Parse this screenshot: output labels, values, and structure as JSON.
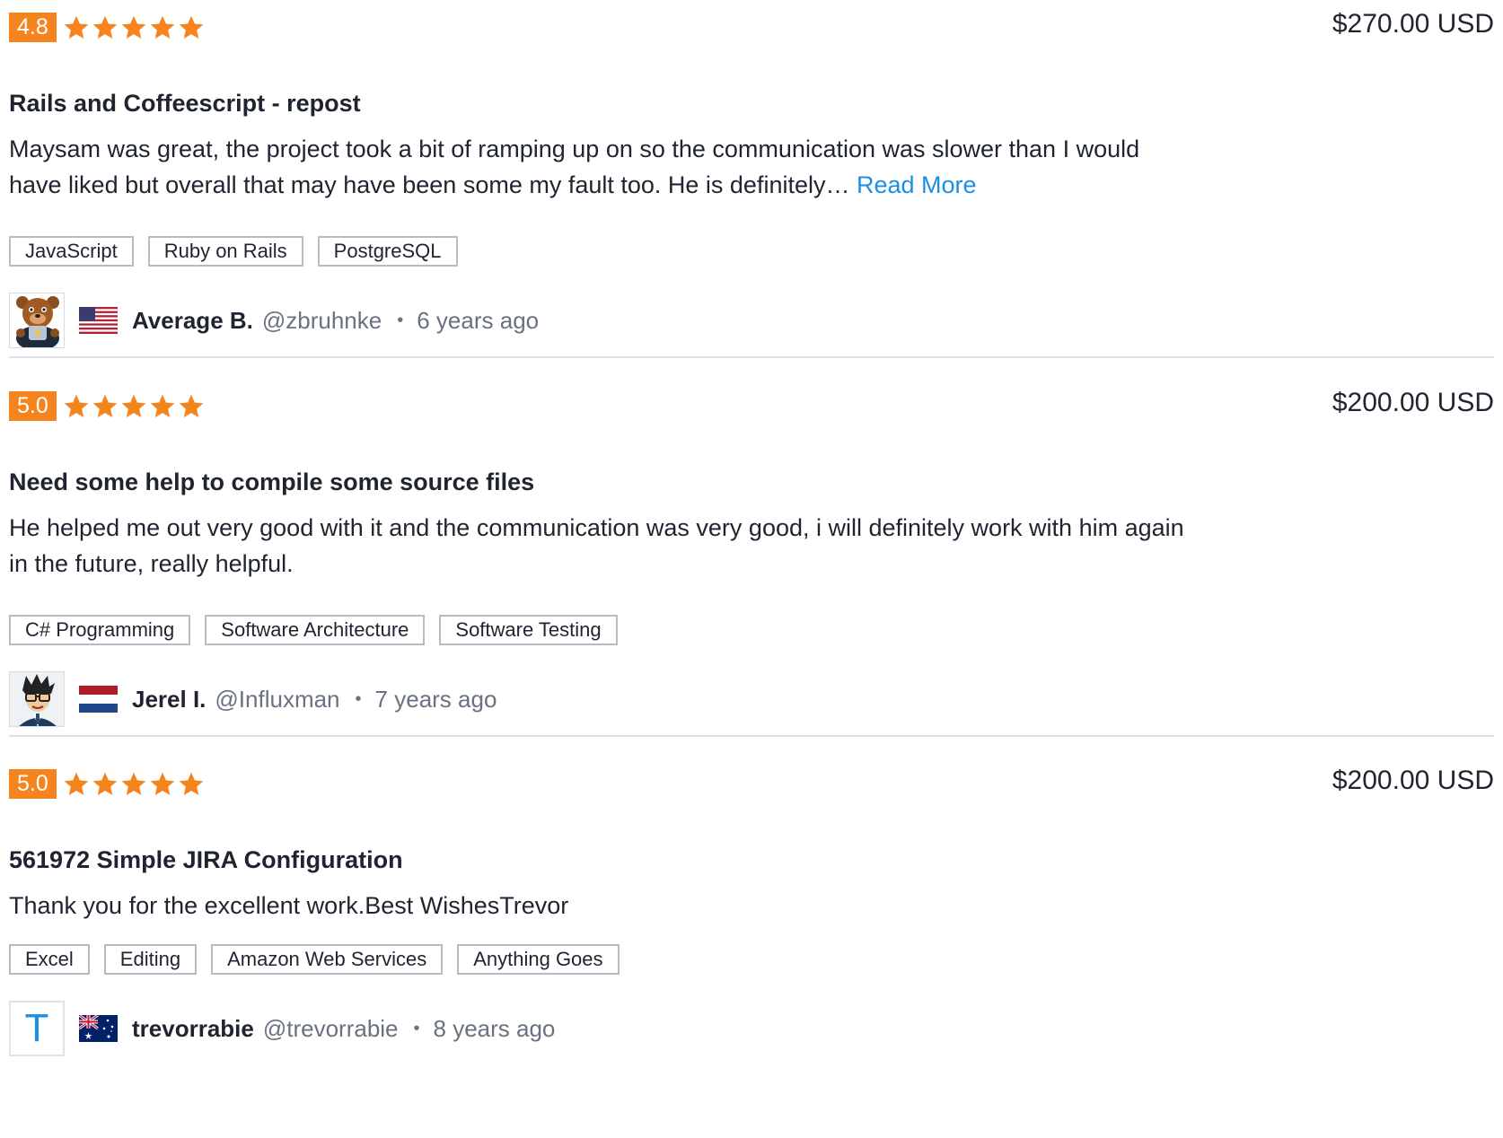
{
  "colors": {
    "accent": "#f5841f",
    "link": "#1a8fe3",
    "text": "#1f2430",
    "muted": "#6a7180",
    "tag_border": "#b7bcc4"
  },
  "reviews": [
    {
      "rating": "4.8",
      "stars": 5,
      "price": "$270.00 USD",
      "title": "Rails and Coffeescript - repost",
      "body": "Maysam was great, the project took a bit of ramping up on so the communication was slower than I would have liked but overall that may have been some my fault too. He is definitely…",
      "read_more": "Read More",
      "tags": [
        "JavaScript",
        "Ruby on Rails",
        "PostgreSQL"
      ],
      "user": {
        "name": "Average B.",
        "handle": "@zbruhnke",
        "time": "6 years ago",
        "flag": "us-flag-icon",
        "avatar": "bear-avatar"
      }
    },
    {
      "rating": "5.0",
      "stars": 5,
      "price": "$200.00 USD",
      "title": "Need some help to compile some source files",
      "body": "He helped me out very good with it and the communication was very good, i will definitely work with him again in the future, really helpful.",
      "tags": [
        "C# Programming",
        "Software Architecture",
        "Software Testing"
      ],
      "user": {
        "name": "Jerel I.",
        "handle": "@Influxman",
        "time": "7 years ago",
        "flag": "nl-flag-icon",
        "avatar": "cartoon-man-avatar"
      }
    },
    {
      "rating": "5.0",
      "stars": 5,
      "price": "$200.00 USD",
      "title": "561972 Simple JIRA Configuration",
      "body": "Thank you for the excellent work.Best WishesTrevor",
      "tags": [
        "Excel",
        "Editing",
        "Amazon Web Services",
        "Anything Goes"
      ],
      "user": {
        "name": "trevorrabie",
        "handle": "@trevorrabie",
        "time": "8 years ago",
        "flag": "au-flag-icon",
        "avatar_letter": "T"
      }
    }
  ],
  "separator": "•"
}
